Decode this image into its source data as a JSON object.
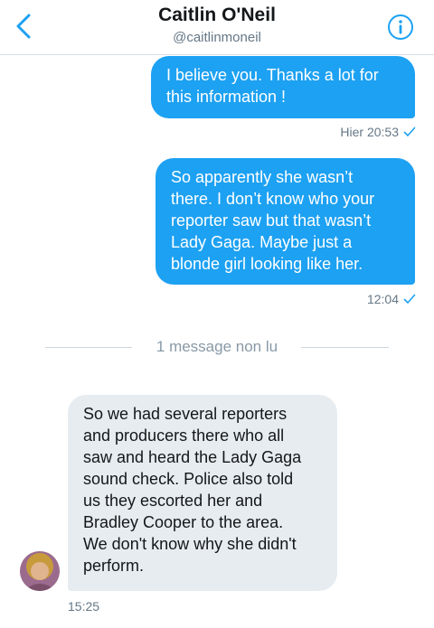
{
  "header": {
    "name": "Caitlin O'Neil",
    "handle": "@caitlinmoneil",
    "back_icon": "chevron-left-icon",
    "info_icon": "info-icon",
    "accent_color": "#1da1f2"
  },
  "messages": [
    {
      "direction": "outgoing",
      "lines": [
        "I believe you. Thanks a lot for",
        "this information !"
      ],
      "time": "Hier 20:53",
      "status_icon": "checkmark-icon"
    },
    {
      "direction": "outgoing",
      "lines": [
        "So apparently she wasn’t",
        "there. I don’t know who your",
        "reporter saw but that wasn’t",
        "Lady Gaga. Maybe just a",
        "blonde girl looking like her."
      ],
      "time": "12:04",
      "status_icon": "checkmark-icon"
    },
    {
      "direction": "incoming",
      "lines": [
        "So we had several reporters",
        "and producers there who all",
        "saw and heard the Lady Gaga",
        "sound check.  Police also told",
        "us they escorted her and",
        "Bradley Cooper to the area.",
        "We don't know why she didn't",
        "perform."
      ],
      "time": "15:25"
    }
  ],
  "unread_divider": "1 message non lu"
}
